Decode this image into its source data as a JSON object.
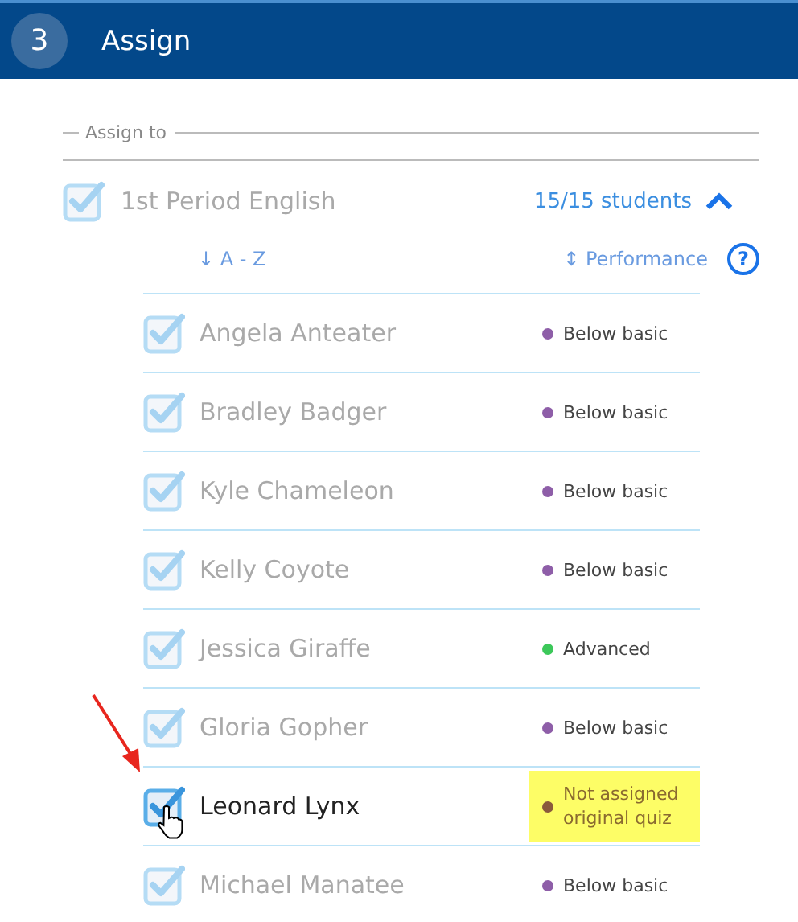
{
  "header": {
    "step": "3",
    "title": "Assign"
  },
  "section_label": "Assign to",
  "class": {
    "name": "1st Period English",
    "checked": true,
    "disabled": true,
    "count": "15/15 students",
    "expanded": true
  },
  "sort": {
    "alpha": "↓ A - Z",
    "performance": "↕ Performance",
    "help": "?"
  },
  "students": [
    {
      "name": "Angela Anteater",
      "checked": true,
      "disabled": true,
      "status": "Below basic",
      "color": "#8e5ea8",
      "highlighted": false
    },
    {
      "name": "Bradley Badger",
      "checked": true,
      "disabled": true,
      "status": "Below basic",
      "color": "#8e5ea8",
      "highlighted": false
    },
    {
      "name": "Kyle Chameleon",
      "checked": true,
      "disabled": true,
      "status": "Below basic",
      "color": "#8e5ea8",
      "highlighted": false
    },
    {
      "name": "Kelly Coyote",
      "checked": true,
      "disabled": true,
      "status": "Below basic",
      "color": "#8e5ea8",
      "highlighted": false
    },
    {
      "name": "Jessica Giraffe",
      "checked": true,
      "disabled": true,
      "status": "Advanced",
      "color": "#3cc85a",
      "highlighted": false
    },
    {
      "name": "Gloria Gopher",
      "checked": true,
      "disabled": true,
      "status": "Below basic",
      "color": "#8e5ea8",
      "highlighted": false
    },
    {
      "name": "Leonard Lynx",
      "checked": true,
      "disabled": false,
      "status": "Not assigned original quiz",
      "color": "#8a5a3c",
      "highlighted": true
    },
    {
      "name": "Michael Manatee",
      "checked": true,
      "disabled": true,
      "status": "Below basic",
      "color": "#8e5ea8",
      "highlighted": false
    }
  ]
}
